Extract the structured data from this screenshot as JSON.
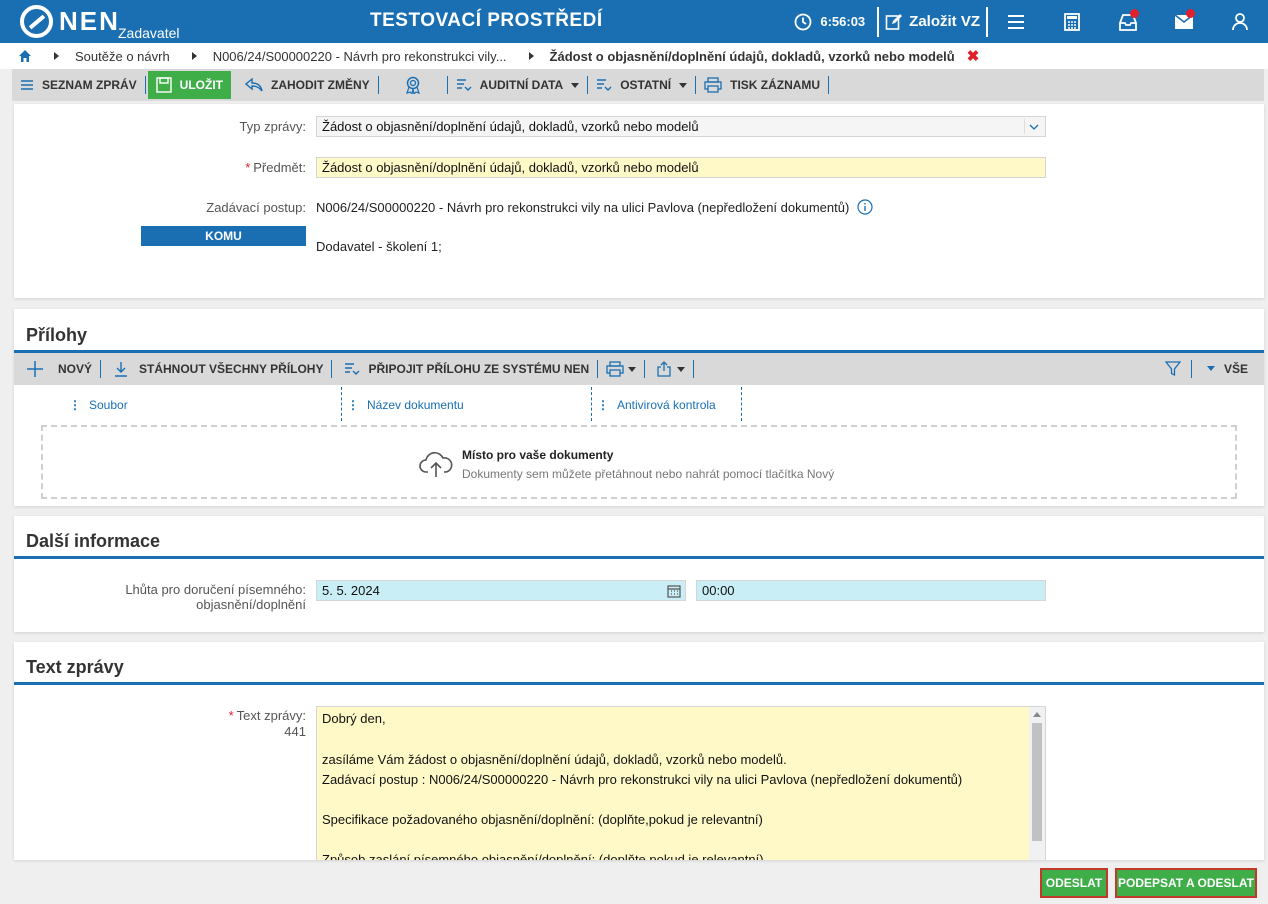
{
  "header": {
    "logo_text": "NEN",
    "logo_sub": "Zadavatel",
    "env_title": "TESTOVACÍ PROSTŘEDÍ",
    "time": "6:56:03",
    "create_label": "Založit VZ"
  },
  "breadcrumb": {
    "items": [
      "Soutěže o návrh",
      "N006/24/S00000220 - Návrh pro rekonstrukci vily...",
      "Žádost o objasnění/doplnění údajů, dokladů, vzorků nebo modelů"
    ]
  },
  "toolbar": {
    "list_label": "SEZNAM ZPRÁV",
    "save_label": "ULOŽIT",
    "discard_label": "ZAHODIT ZMĚNY",
    "audit_label": "AUDITNÍ DATA",
    "other_label": "OSTATNÍ",
    "print_label": "TISK ZÁZNAMU"
  },
  "form": {
    "type_label": "Typ zprávy:",
    "type_value": "Žádost o objasnění/doplnění údajů, dokladů, vzorků nebo modelů",
    "subject_label": "Předmět:",
    "subject_value": "Žádost o objasnění/doplnění údajů, dokladů, vzorků nebo modelů",
    "procedure_label": "Zadávací postup:",
    "procedure_value": "N006/24/S00000220 - Návrh pro rekonstrukci vily na ulici Pavlova (nepředložení dokumentů)",
    "to_button": "KOMU",
    "to_value": "Dodavatel - školení 1;"
  },
  "attachments": {
    "title": "Přílohy",
    "new_label": "NOVÝ",
    "download_all_label": "STÁHNOUT VŠECHNY PŘÍLOHY",
    "attach_label": "PŘIPOJIT PŘÍLOHU ZE SYSTÉMU NEN",
    "all_label": "VŠE",
    "columns": [
      "Soubor",
      "Název dokumentu",
      "Antivirová kontrola"
    ],
    "drop_title": "Místo pro vaše dokumenty",
    "drop_hint": "Dokumenty sem můžete přetáhnout nebo nahrát pomocí tlačítka Nový"
  },
  "more_info": {
    "title": "Další informace",
    "deadline_label_1": "Lhůta pro doručení písemného:",
    "deadline_label_2": "objasnění/doplnění",
    "date_value": "5. 5. 2024",
    "time_value": "00:00"
  },
  "message": {
    "title": "Text zprávy",
    "label": "Text zprávy:",
    "count": "441",
    "lines": [
      "Dobrý den,",
      "",
      "zasíláme Vám žádost o objasnění/doplnění údajů, dokladů, vzorků nebo modelů.",
      "Zadávací postup : N006/24/S00000220 - Návrh pro rekonstrukci vily na ulici Pavlova (nepředložení dokumentů)",
      "",
      "Specifikace požadovaného objasnění/doplnění: (doplňte,pokud je relevantní)",
      "",
      "Způsob zaslání písemného objasnění/doplnění: (doplňte,pokud je relevantní)"
    ]
  },
  "footer": {
    "send_label": "ODESLAT",
    "sign_send_label": "PODEPSAT A ODESLAT"
  },
  "colors": {
    "brand_blue": "#1a6fb3",
    "green": "#3fae49",
    "required_yellow": "#fff9c8",
    "date_cyan": "#c9eef5",
    "alert_red": "#e0202a"
  }
}
